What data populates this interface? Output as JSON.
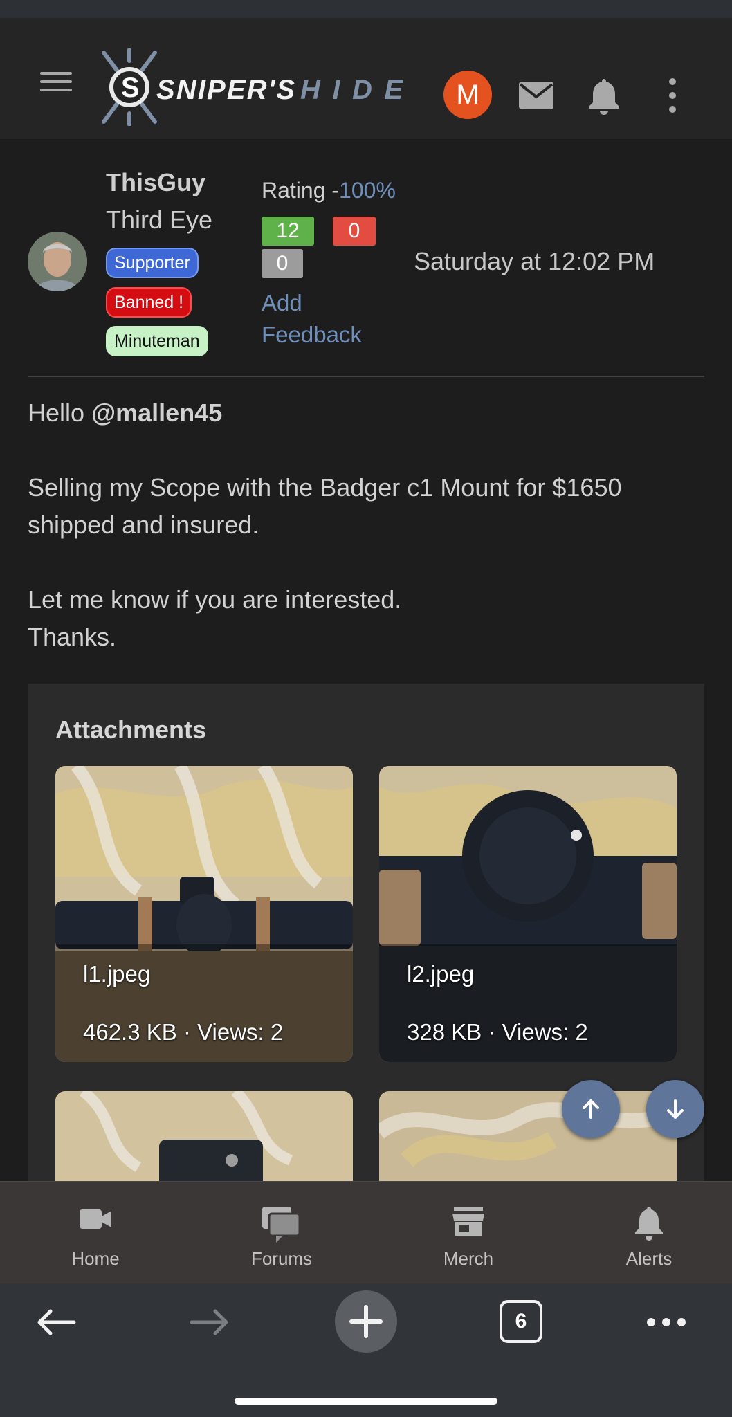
{
  "header": {
    "logo_text": "SNIPER'S HIDE",
    "avatar_letter": "M"
  },
  "post": {
    "username": "ThisGuy",
    "user_title": "Third Eye",
    "badges": [
      "Supporter",
      "Banned !",
      "Minuteman"
    ],
    "rating_label": "Rating -",
    "rating_value": "100%",
    "feedback_positive": "12",
    "feedback_negative": "0",
    "feedback_neutral": "0",
    "add_feedback": "Add Feedback",
    "date": "Saturday at 12:02 PM",
    "greeting": "Hello ",
    "mention": "@mallen45",
    "body_1": "Selling my Scope with the Badger c1 Mount for $1650 shipped and insured.",
    "body_2": "Let me know if you are interested.",
    "body_3": "Thanks."
  },
  "attachments": {
    "title": "Attachments",
    "items": [
      {
        "name": "l1.jpeg",
        "meta": "462.3 KB · Views: 2"
      },
      {
        "name": "l2.jpeg",
        "meta": "328 KB · Views: 2"
      }
    ]
  },
  "bottom_nav": {
    "items": [
      {
        "label": "Home",
        "icon": "video-camera-icon"
      },
      {
        "label": "Forums",
        "icon": "chat-bubbles-icon"
      },
      {
        "label": "Merch",
        "icon": "store-icon"
      },
      {
        "label": "Alerts",
        "icon": "bell-icon"
      }
    ]
  },
  "browser": {
    "tab_count": "6"
  },
  "colors": {
    "link": "#6f8fbb",
    "positive": "#5fb24a",
    "negative": "#e24c41",
    "neutral": "#9c9c9c",
    "avatar": "#e4521f"
  }
}
